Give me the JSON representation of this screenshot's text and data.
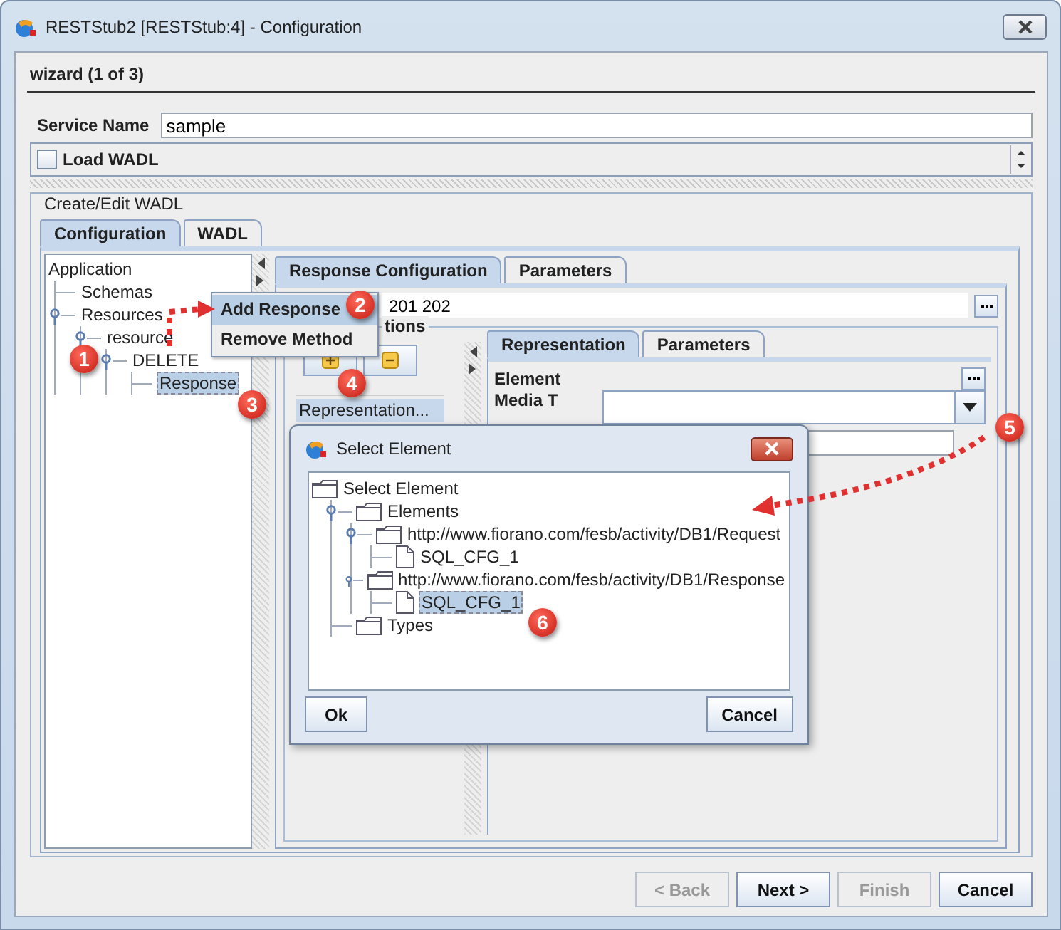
{
  "window": {
    "title": "RESTStub2 [RESTStub:4] - Configuration"
  },
  "wizard": {
    "step_title": "wizard (1 of 3)"
  },
  "service_name": {
    "label": "Service Name",
    "value": "sample"
  },
  "load_wadl": {
    "label": "Load WADL",
    "checked": false
  },
  "group": {
    "title": "Create/Edit WADL"
  },
  "tabs": [
    {
      "label": "Configuration",
      "selected": true
    },
    {
      "label": "WADL",
      "selected": false
    }
  ],
  "tree": [
    {
      "label": "Application",
      "selected": false,
      "children": [
        {
          "label": "Schemas",
          "selected": false
        },
        {
          "label": "Resources",
          "selected": false,
          "expanded": true,
          "children": [
            {
              "label": "resource",
              "selected": false,
              "expanded": true,
              "children": [
                {
                  "label": "DELETE",
                  "selected": false,
                  "expanded": true,
                  "children": [
                    {
                      "label": "Response",
                      "selected": true
                    }
                  ]
                }
              ]
            }
          ]
        }
      ]
    }
  ],
  "response_tabs": [
    {
      "label": "Response Configuration",
      "selected": true
    },
    {
      "label": "Parameters",
      "selected": false
    }
  ],
  "status_field": {
    "value": "201 202"
  },
  "representations": {
    "legend": "tions",
    "list": [
      {
        "label": "Representation...",
        "selected": true
      }
    ]
  },
  "representation_tabs": [
    {
      "label": "Representation",
      "selected": true
    },
    {
      "label": "Parameters",
      "selected": false
    }
  ],
  "element": {
    "label": "Element"
  },
  "media_type": {
    "label": "Media T"
  },
  "context_menu": [
    {
      "label": "Add Response",
      "selected": true
    },
    {
      "label": "Remove  Method",
      "selected": false
    }
  ],
  "dialog": {
    "title": "Select Element",
    "tree": [
      {
        "label": "Select Element",
        "kind": "folder",
        "selected": false,
        "children": [
          {
            "label": "Elements",
            "kind": "folder",
            "selected": false,
            "expanded": true,
            "children": [
              {
                "label": "http://www.fiorano.com/fesb/activity/DB1/Request",
                "kind": "folder",
                "selected": false,
                "expanded": true,
                "children": [
                  {
                    "label": "SQL_CFG_1",
                    "kind": "file",
                    "selected": false
                  }
                ]
              },
              {
                "label": "http://www.fiorano.com/fesb/activity/DB1/Response",
                "kind": "folder",
                "selected": false,
                "expanded": true,
                "children": [
                  {
                    "label": "SQL_CFG_1",
                    "kind": "file",
                    "selected": true
                  }
                ]
              }
            ]
          },
          {
            "label": "Types",
            "kind": "folder",
            "selected": false
          }
        ]
      }
    ],
    "buttons": [
      "Ok",
      "Cancel"
    ]
  },
  "steps": [
    "1",
    "2",
    "3",
    "4",
    "5",
    "6"
  ],
  "buttons": [
    {
      "label": "< Back",
      "disabled": true
    },
    {
      "label": "Next >",
      "disabled": false
    },
    {
      "label": "Finish",
      "disabled": true
    },
    {
      "label": "Cancel",
      "disabled": false
    }
  ]
}
